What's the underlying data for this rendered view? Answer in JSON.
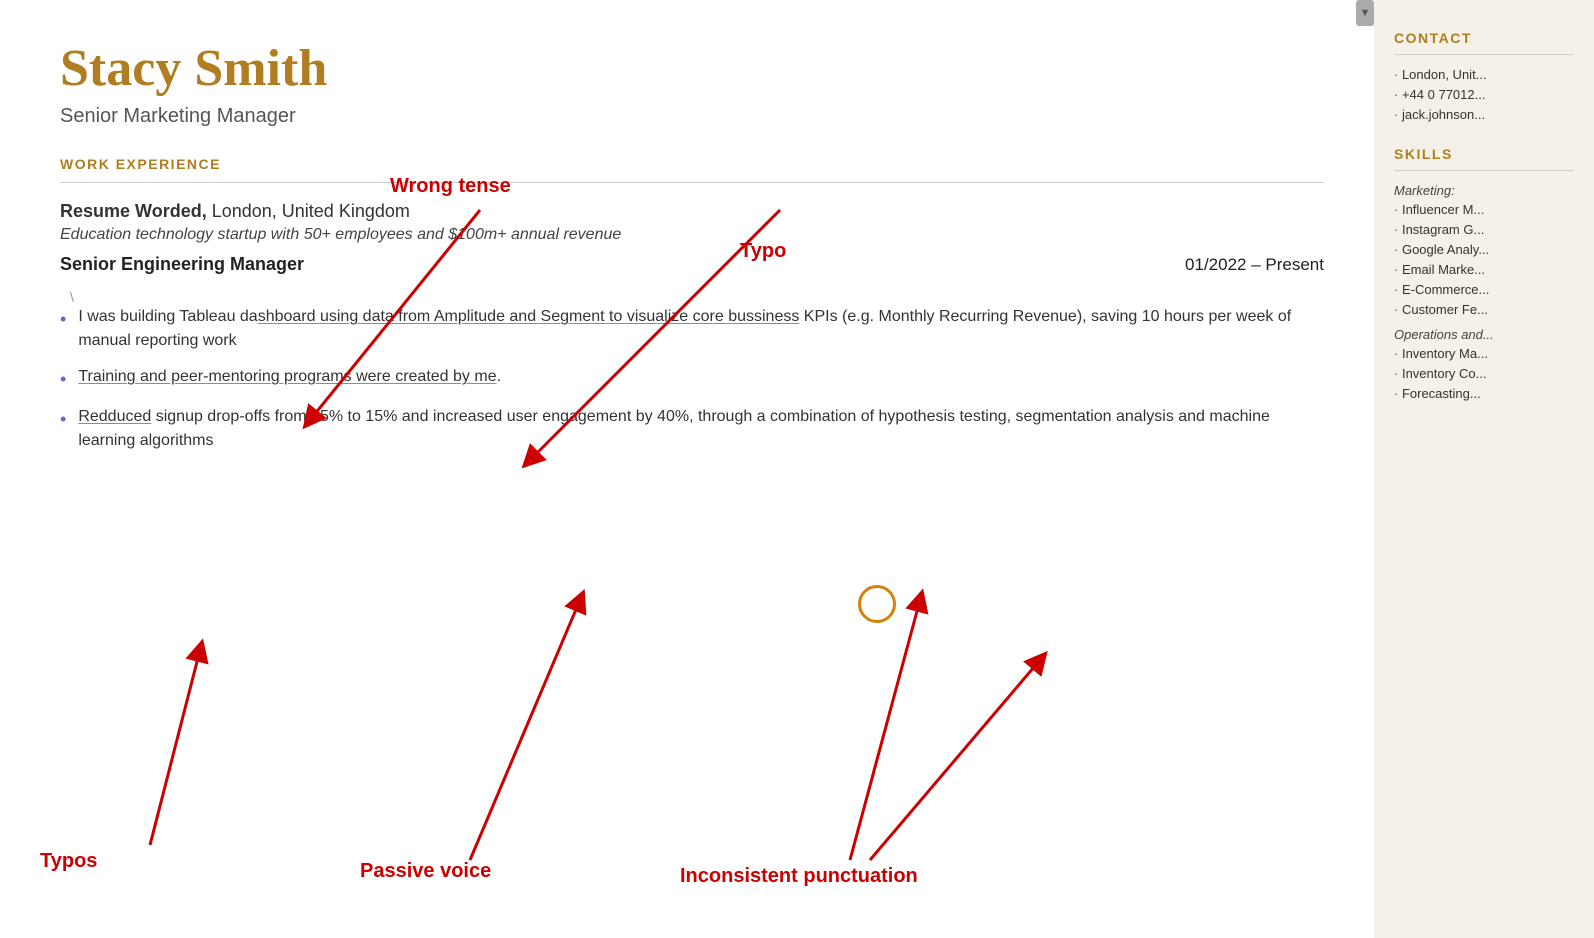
{
  "scrollbar": {
    "icon": "▼"
  },
  "main": {
    "candidate": {
      "name": "Stacy Smith",
      "title": "Senior Marketing Manager"
    },
    "sections": {
      "work_experience": {
        "heading": "WORK EXPERIENCE",
        "company": {
          "name": "Resume Worded",
          "location": "London, United Kingdom",
          "description": "Education technology startup with 50+ employees and $100m+ annual revenue"
        },
        "role": {
          "title": "Senior Engineering Manager",
          "dates": "01/2022 – Present"
        },
        "bullets": [
          {
            "text_before_underline": "I was building Tableau da",
            "underline_text": "shboard using data from Amplitude and Segment to visualize core ",
            "underline_text2": "bussiness",
            "text_after_underline": " KPIs (e.g. Monthly Recurring Revenue), saving 10 hours per week of manual reporting work",
            "has_underline": true
          },
          {
            "text": "Training and peer-mentoring programs were created by me.",
            "has_circle": true,
            "circle_word": "me"
          },
          {
            "text_before_underline": "",
            "underline_text": "Redduced",
            "text_after_underline": " signup drop-offs from 65% to 15% and increased user engagement by 40%, through a combination of hypothesis testing, segmentation analysis and machine learning algorithms",
            "has_underline": true
          }
        ]
      }
    }
  },
  "annotations": {
    "wrong_tense": "Wrong tense",
    "typo_top": "Typo",
    "typos_bottom": "Typos",
    "passive_voice": "Passive voice",
    "inconsistent_punctuation": "Inconsistent punctuation"
  },
  "sidebar": {
    "contact": {
      "heading": "CONTACT",
      "items": [
        "London, Unit...",
        "+44 0 77012...",
        "jack.johnson..."
      ]
    },
    "skills": {
      "heading": "SKILLS",
      "categories": [
        {
          "name": "Marketing:",
          "items": [
            "Influencer M...",
            "Instagram G...",
            "Google Analy...",
            "Email Marke...",
            "E-Commerce...",
            "Customer Fe..."
          ]
        },
        {
          "name": "Operations and...",
          "items": [
            "Inventory Ma...",
            "Inventory Co...",
            "Forecasting..."
          ]
        }
      ]
    }
  }
}
